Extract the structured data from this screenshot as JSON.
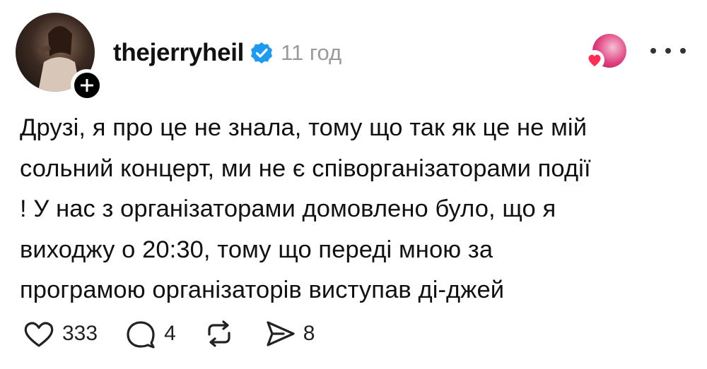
{
  "post": {
    "username": "thejerryheil",
    "time": "11 год",
    "text_lines": [
      "Друзі, я про це не знала, тому що так як це не мій",
      "сольний концерт, ми не є співорганізаторами події",
      "! У нас з організаторами домовлено було, що я",
      "виходжу о 20:30, тому що переді мною за",
      "програмою організаторів виступав ді-джей"
    ]
  },
  "actions": {
    "likes": "333",
    "comments": "4",
    "shares": "8"
  },
  "icons": {
    "verified": "verified-badge-icon",
    "like": "heart-icon",
    "comment": "comment-icon",
    "repost": "repost-icon",
    "share": "send-icon",
    "more": "more-dots-icon",
    "follow": "plus-icon"
  },
  "colors": {
    "verified": "#1d9bf0",
    "heart": "#ff2d55",
    "muted": "#9a9a9a"
  }
}
